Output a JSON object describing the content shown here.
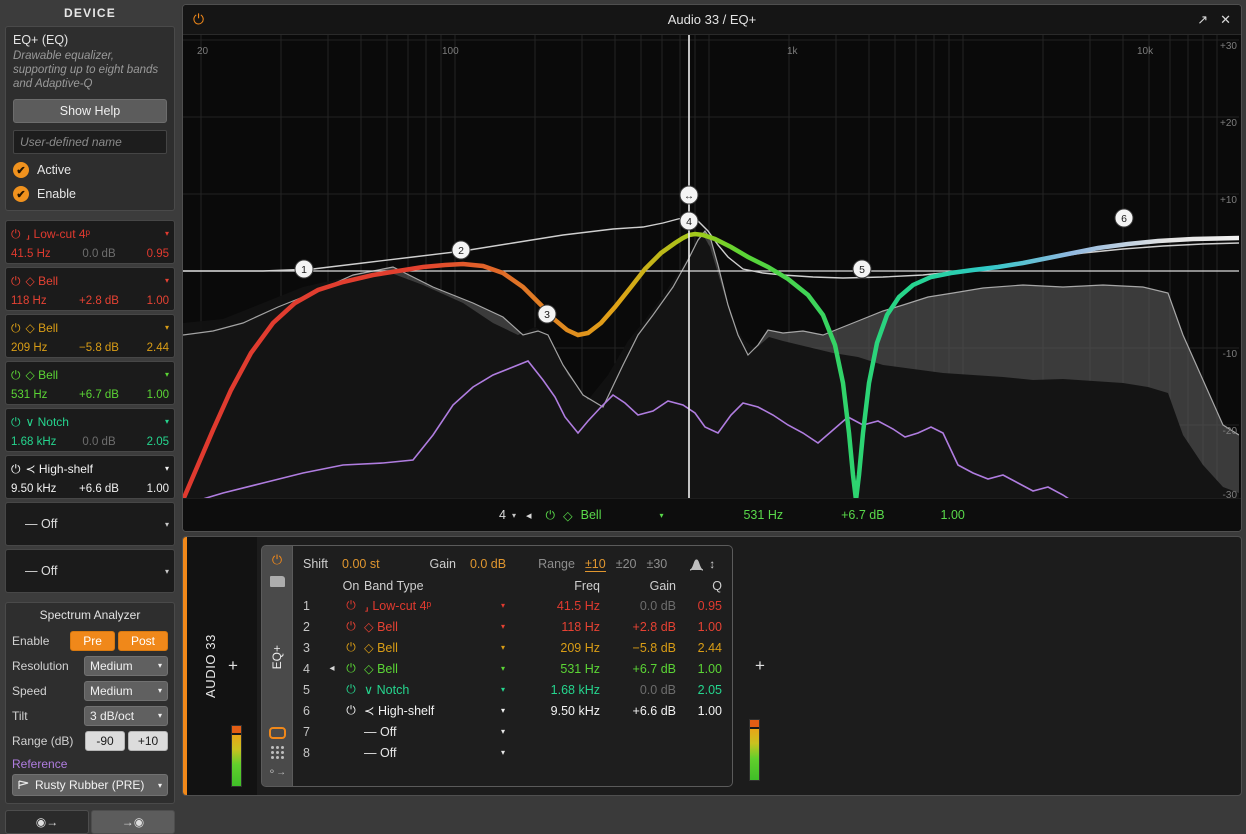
{
  "sidebar": {
    "header": "DEVICE",
    "device_title": "EQ+ (EQ)",
    "device_desc": "Drawable equalizer, supporting up to eight bands and Adaptive-Q",
    "show_help": "Show Help",
    "name_placeholder": "User-defined name",
    "active_label": "Active",
    "enable_label": "Enable",
    "check_glyph": "✔",
    "power_glyph": "⏻",
    "caret_glyph": "▾",
    "bands": [
      {
        "type": "Low-cut 4ᵖ",
        "shape": "⸥",
        "freq": "41.5 Hz",
        "gain": "0.0 dB",
        "q": "0.95",
        "color": "#e03a2f",
        "gain_dim": true
      },
      {
        "type": "Bell",
        "shape": "◇",
        "freq": "118 Hz",
        "gain": "+2.8 dB",
        "q": "1.00",
        "color": "#e64233",
        "gain_dim": false
      },
      {
        "type": "Bell",
        "shape": "◇",
        "freq": "209 Hz",
        "gain": "−5.8 dB",
        "q": "2.44",
        "color": "#d99d16",
        "gain_dim": false
      },
      {
        "type": "Bell",
        "shape": "◇",
        "freq": "531 Hz",
        "gain": "+6.7 dB",
        "q": "1.00",
        "color": "#5bd535",
        "gain_dim": false
      },
      {
        "type": "Notch",
        "shape": "∨",
        "freq": "1.68 kHz",
        "gain": "0.0 dB",
        "q": "2.05",
        "color": "#25d58e",
        "gain_dim": true
      },
      {
        "type": "High-shelf",
        "shape": "≺",
        "freq": "9.50 kHz",
        "gain": "+6.6 dB",
        "q": "1.00",
        "color": "#f2f2f2",
        "gain_dim": false
      }
    ],
    "off_bands": [
      {
        "label": "Off",
        "dash": "—"
      },
      {
        "label": "Off",
        "dash": "—"
      }
    ],
    "analyzer": {
      "title": "Spectrum Analyzer",
      "enable_label": "Enable",
      "pre_label": "Pre",
      "post_label": "Post",
      "resolution_label": "Resolution",
      "resolution_value": "Medium",
      "speed_label": "Speed",
      "speed_value": "Medium",
      "tilt_label": "Tilt",
      "tilt_value": "3 dB/oct",
      "range_label": "Range (dB)",
      "range_min": "-90",
      "range_max": "+10",
      "reference_label": "Reference",
      "reference_value": "Rusty Rubber (PRE)"
    },
    "foot_left": "◉→",
    "foot_right": "→◉"
  },
  "plugin": {
    "title": "Audio 33 / EQ+",
    "power_glyph": "⏻",
    "popout_glyph": "↗",
    "close_glyph": "✕",
    "freq_ticks": [
      "20",
      "100",
      "1k",
      "10k"
    ],
    "db_ticks": [
      "+30",
      "+20",
      "+10",
      "-10",
      "-20",
      "-30"
    ],
    "markers": [
      "1",
      "2",
      "3",
      "4",
      "5",
      "6"
    ],
    "footer": {
      "band_index": "4",
      "caret": "▾",
      "speaker": "◂",
      "power": "⏻",
      "shape": "◇",
      "band_type": "Bell",
      "freq": "531 Hz",
      "gain": "+6.7 dB",
      "q": "1.00"
    }
  },
  "rack": {
    "track_name": "AUDIO 33",
    "plus": "+",
    "device_name": "EQ+",
    "power_glyph": "⏻",
    "header": {
      "shift_label": "Shift",
      "shift_value": "0.00 st",
      "gain_label": "Gain",
      "gain_value": "0.0 dB",
      "range_label": "Range",
      "range_options": [
        "±10",
        "±20",
        "±30"
      ],
      "range_selected": "±10",
      "bell_icon": "bell-curve-icon",
      "updown_icon": "↕"
    },
    "columns": [
      "On",
      "Band Type",
      "Freq",
      "Gain",
      "Q"
    ],
    "rows": [
      {
        "idx": "1",
        "speaker": "",
        "on": "⏻",
        "shape": "⸥",
        "type": "Low-cut 4ᵖ",
        "freq": "41.5 Hz",
        "gain": "0.0 dB",
        "q": "0.95",
        "color": "#e03a2f",
        "gain_dim": true
      },
      {
        "idx": "2",
        "speaker": "",
        "on": "⏻",
        "shape": "◇",
        "type": "Bell",
        "freq": "118 Hz",
        "gain": "+2.8 dB",
        "q": "1.00",
        "color": "#e64233",
        "gain_dim": false
      },
      {
        "idx": "3",
        "speaker": "",
        "on": "⏻",
        "shape": "◇",
        "type": "Bell",
        "freq": "209 Hz",
        "gain": "−5.8 dB",
        "q": "2.44",
        "color": "#d99d16",
        "gain_dim": false
      },
      {
        "idx": "4",
        "speaker": "◂",
        "on": "⏻",
        "shape": "◇",
        "type": "Bell",
        "freq": "531 Hz",
        "gain": "+6.7 dB",
        "q": "1.00",
        "color": "#5bd535",
        "gain_dim": false
      },
      {
        "idx": "5",
        "speaker": "",
        "on": "⏻",
        "shape": "∨",
        "type": "Notch",
        "freq": "1.68 kHz",
        "gain": "0.0 dB",
        "q": "2.05",
        "color": "#25d58e",
        "gain_dim": true
      },
      {
        "idx": "6",
        "speaker": "",
        "on": "⏻",
        "shape": "≺",
        "type": "High-shelf",
        "freq": "9.50 kHz",
        "gain": "+6.6 dB",
        "q": "1.00",
        "color": "#f2f2f2",
        "gain_dim": false
      },
      {
        "idx": "7",
        "speaker": "",
        "on": "",
        "shape": "—",
        "type": "Off",
        "freq": "",
        "gain": "",
        "q": "",
        "color": "#e8e8e8",
        "gain_dim": false
      },
      {
        "idx": "8",
        "speaker": "",
        "on": "",
        "shape": "—",
        "type": "Off",
        "freq": "",
        "gain": "",
        "q": "",
        "color": "#e8e8e8",
        "gain_dim": false
      }
    ]
  },
  "colors": {
    "accent": "#f0881a",
    "band1": "#e03a2f",
    "band2": "#e64233",
    "band3": "#d99d16",
    "band4": "#5bd535",
    "band5": "#25d58e",
    "band6": "#f2f2f2",
    "spectrum_pre": "#b07de0",
    "panel_bg": "#2e2e2e"
  }
}
